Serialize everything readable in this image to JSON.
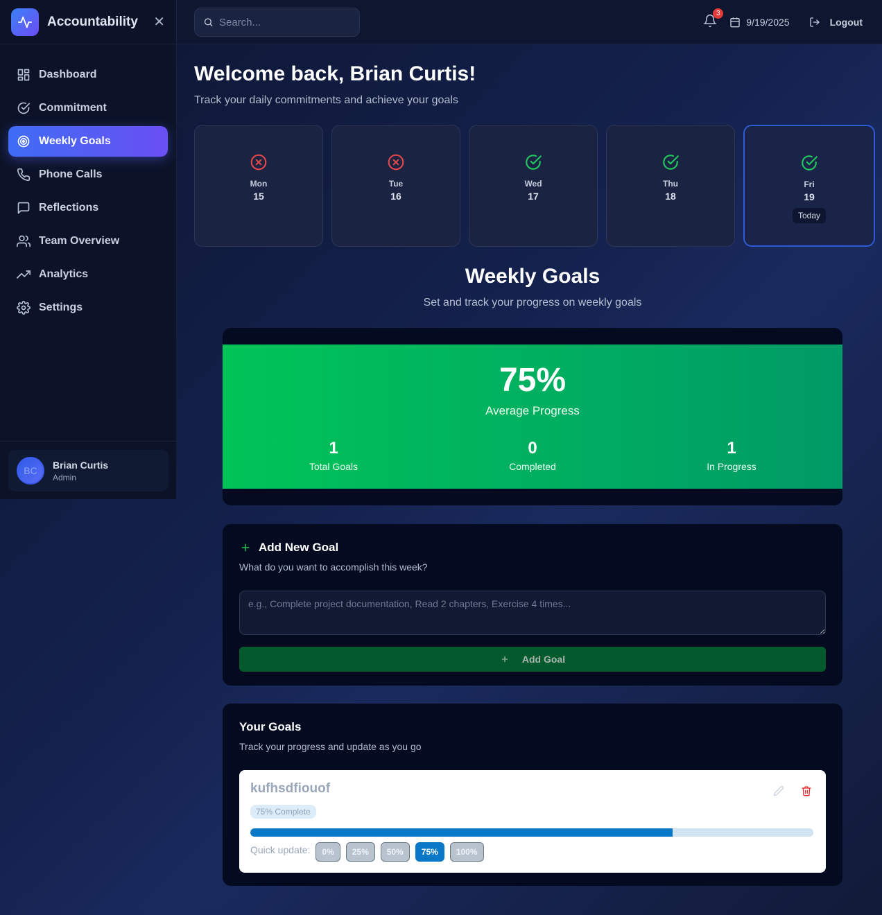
{
  "app": {
    "title": "Accountability"
  },
  "sidebar": {
    "items": [
      {
        "label": "Dashboard",
        "icon": "dashboard-icon"
      },
      {
        "label": "Commitment",
        "icon": "check-circle-icon"
      },
      {
        "label": "Weekly Goals",
        "icon": "target-icon",
        "active": true
      },
      {
        "label": "Phone Calls",
        "icon": "phone-icon"
      },
      {
        "label": "Reflections",
        "icon": "message-icon"
      },
      {
        "label": "Team Overview",
        "icon": "users-icon"
      },
      {
        "label": "Analytics",
        "icon": "trending-up-icon"
      },
      {
        "label": "Settings",
        "icon": "gear-icon"
      }
    ],
    "user": {
      "initials": "BC",
      "name": "Brian Curtis",
      "role": "Admin"
    }
  },
  "topbar": {
    "search_placeholder": "Search...",
    "notifications_count": "3",
    "date": "9/19/2025",
    "logout_label": "Logout"
  },
  "welcome": {
    "title": "Welcome back, Brian Curtis!",
    "subtitle": "Track your daily commitments and achieve your goals"
  },
  "days": [
    {
      "name": "Mon",
      "num": "15",
      "status": "missed"
    },
    {
      "name": "Tue",
      "num": "16",
      "status": "missed"
    },
    {
      "name": "Wed",
      "num": "17",
      "status": "done"
    },
    {
      "name": "Thu",
      "num": "18",
      "status": "done"
    },
    {
      "name": "Fri",
      "num": "19",
      "status": "done",
      "today_label": "Today"
    }
  ],
  "colors": {
    "missed": "#e0474c",
    "done": "#22c55e",
    "accent": "#3f6cf5"
  },
  "weekly": {
    "title": "Weekly Goals",
    "subtitle": "Set and track your progress on weekly goals",
    "average_value": "75%",
    "average_label": "Average Progress",
    "stats": [
      {
        "value": "1",
        "label": "Total Goals"
      },
      {
        "value": "0",
        "label": "Completed"
      },
      {
        "value": "1",
        "label": "In Progress"
      }
    ]
  },
  "add_goal": {
    "title": "Add New Goal",
    "subtitle": "What do you want to accomplish this week?",
    "placeholder": "e.g., Complete project documentation, Read 2 chapters, Exercise 4 times...",
    "button_label": "Add Goal"
  },
  "goals": {
    "title": "Your Goals",
    "subtitle": "Track your progress and update as you go",
    "items": [
      {
        "name": "kufhsdfiouof",
        "badge": "75% Complete",
        "progress": 0.75,
        "quick_label": "Quick update:",
        "quick_options": [
          "0%",
          "25%",
          "50%",
          "75%",
          "100%"
        ],
        "selected": "75%"
      }
    ]
  }
}
